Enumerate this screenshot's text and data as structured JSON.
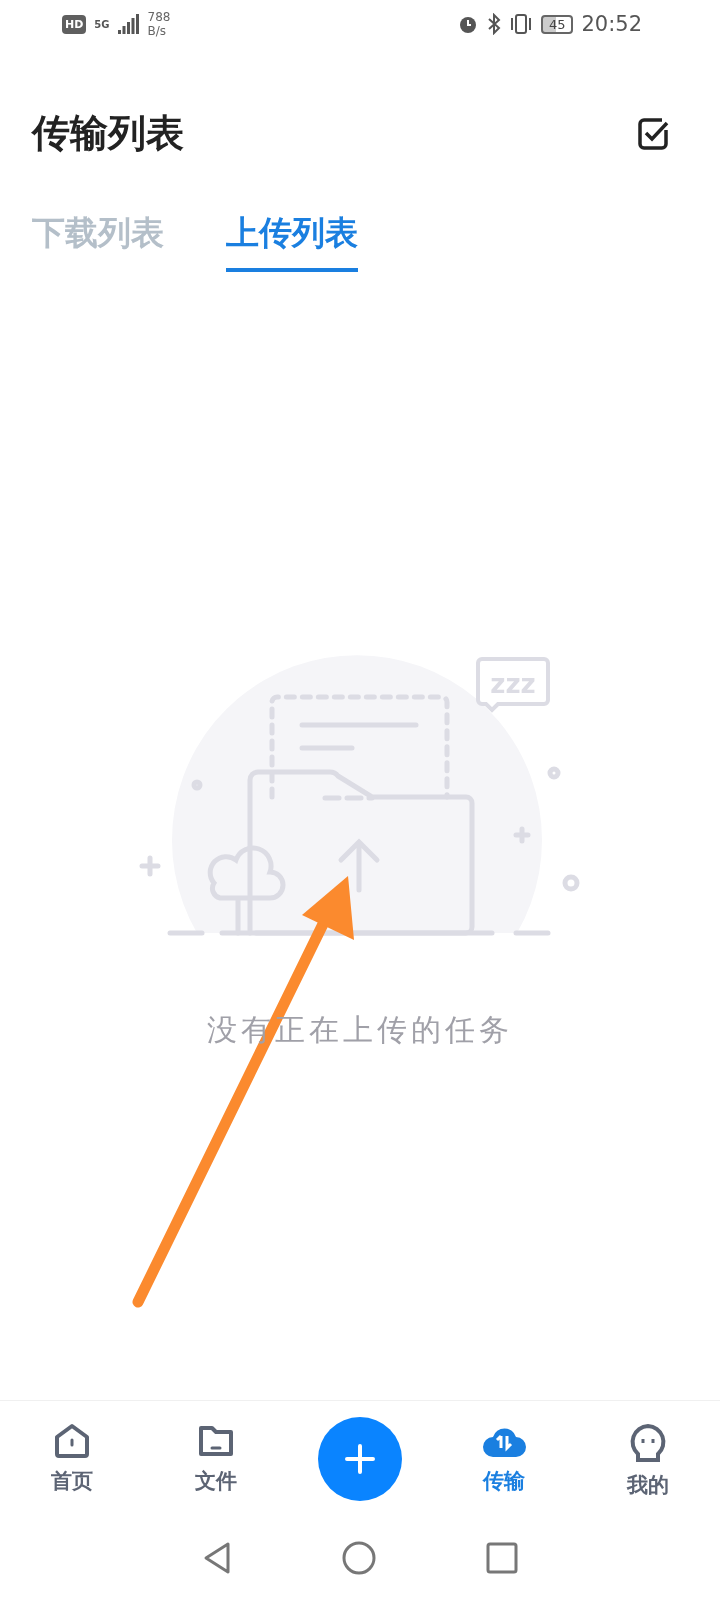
{
  "status_bar": {
    "hd": "HD",
    "network": "5G",
    "speed_value": "788",
    "speed_unit": "B/s",
    "battery": "45",
    "time": "20:52"
  },
  "header": {
    "title": "传输列表"
  },
  "tabs": [
    {
      "label": "下载列表",
      "selected": false
    },
    {
      "label": "上传列表",
      "selected": true
    }
  ],
  "empty_state": {
    "sleep_text": "zzz",
    "message": "没有正在上传的任务"
  },
  "bottom_nav": [
    {
      "kind": "home",
      "label": "首页",
      "selected": false
    },
    {
      "kind": "files",
      "label": "文件",
      "selected": false
    },
    {
      "kind": "add"
    },
    {
      "kind": "transfer",
      "label": "传输",
      "selected": true
    },
    {
      "kind": "me",
      "label": "我的",
      "selected": false
    }
  ]
}
